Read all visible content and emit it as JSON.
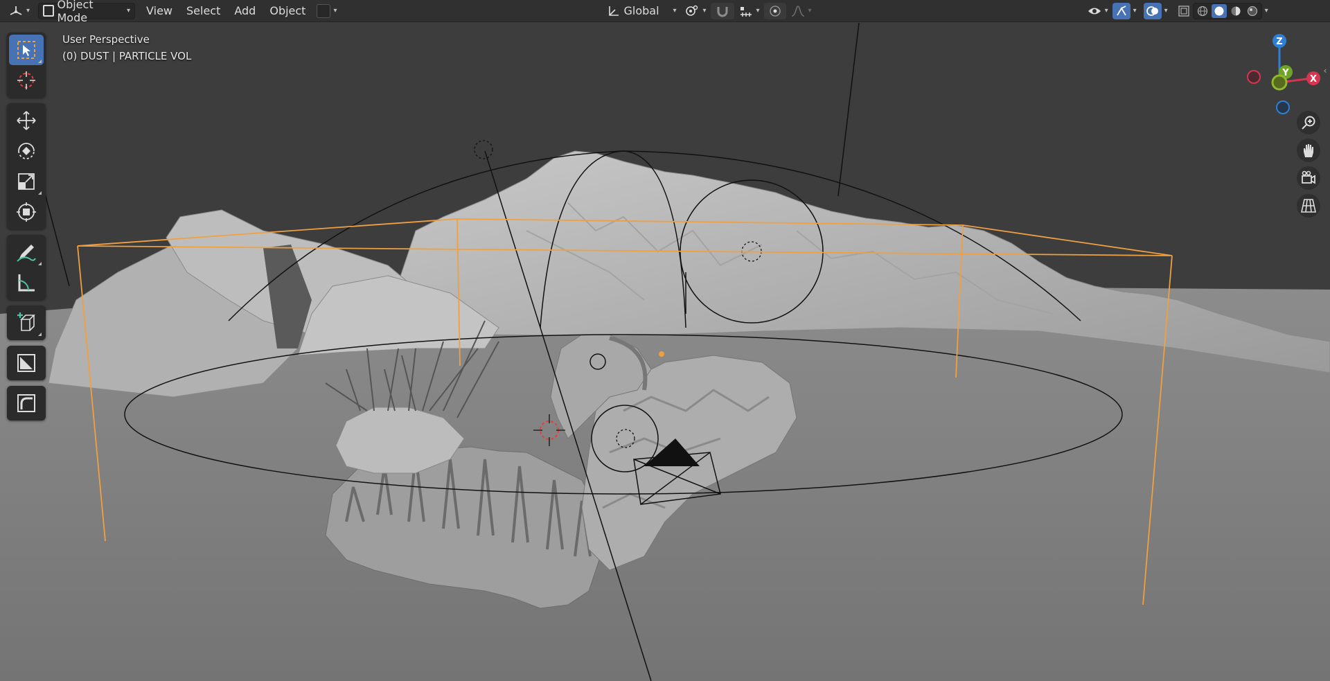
{
  "header": {
    "editor_type_icon": "view3d-icon",
    "mode": "Object Mode",
    "menus": [
      "View",
      "Select",
      "Add",
      "Object"
    ],
    "transform_orientation": "Global",
    "icons": {
      "pivot": "pivot-point-icon",
      "snap": "snap-magnet-icon",
      "snap_target": "snap-increment-icon",
      "proportional": "proportional-edit-icon",
      "falloff": "falloff-curve-icon",
      "visibility": "eye-icon",
      "gizmo": "gizmo-icon",
      "overlays": "overlays-icon",
      "xray": "xray-icon",
      "shading_wire": "wireframe-shading-icon",
      "shading_solid": "solid-shading-icon",
      "shading_material": "material-shading-icon",
      "shading_rendered": "rendered-shading-icon"
    }
  },
  "viewport": {
    "view_name": "User Perspective",
    "object_info": "(0) DUST | PARTICLE VOL"
  },
  "toolbar": {
    "tools": [
      {
        "name": "select-box-tool",
        "icon": "select-box-icon",
        "active": true
      },
      {
        "name": "cursor-tool",
        "icon": "cursor-icon",
        "active": false
      },
      {
        "name": "move-tool",
        "icon": "move-icon",
        "active": false
      },
      {
        "name": "rotate-tool",
        "icon": "rotate-icon",
        "active": false
      },
      {
        "name": "scale-tool",
        "icon": "scale-icon",
        "active": false
      },
      {
        "name": "transform-tool",
        "icon": "transform-icon",
        "active": false
      },
      {
        "name": "annotate-tool",
        "icon": "annotate-icon",
        "active": false
      },
      {
        "name": "measure-tool",
        "icon": "measure-icon",
        "active": false
      },
      {
        "name": "add-cube-tool",
        "icon": "add-cube-icon",
        "active": false
      },
      {
        "name": "shrink-tool",
        "icon": "shrink-icon",
        "active": false
      },
      {
        "name": "curve-tool",
        "icon": "curve-icon",
        "active": false
      }
    ]
  },
  "gizmo": {
    "axes": [
      {
        "label": "Z",
        "color": "#2f7fd6"
      },
      {
        "label": "Y",
        "color": "#6ea326"
      },
      {
        "label": "X",
        "color": "#d6354f"
      }
    ]
  },
  "navigation": {
    "zoom_icon": "zoom-icon",
    "pan_icon": "hand-pan-icon",
    "camera_icon": "camera-view-icon",
    "ortho_icon": "perspective-grid-icon"
  },
  "colors": {
    "accent": "#4772b3",
    "selection": "#f0a040",
    "header_bg": "#303030",
    "ground": "#7a7a7a",
    "sky": "#3d3d3d"
  }
}
